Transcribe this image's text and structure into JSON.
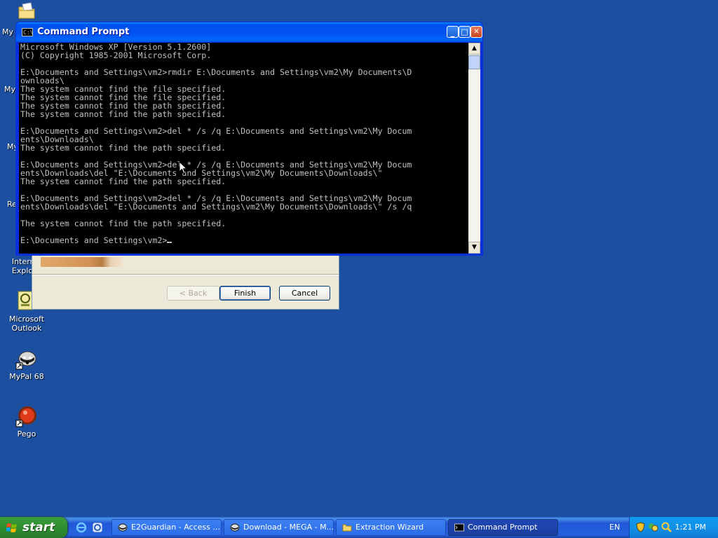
{
  "desktop": {
    "icons": [
      {
        "name": "my-documents-partial",
        "label": "My"
      },
      {
        "name": "my-computer-partial",
        "label": "My"
      },
      {
        "name": "my-network-partial",
        "label": "My"
      },
      {
        "name": "recycle-partial",
        "label": "Re"
      },
      {
        "name": "internet-explorer",
        "label_line1": "Interr",
        "label_line2": "Explo"
      },
      {
        "name": "microsoft-outlook",
        "label_line1": "Microsoft",
        "label_line2": "Outlook"
      },
      {
        "name": "mypal",
        "label": "MyPal 68"
      },
      {
        "name": "pego",
        "label": "Pego"
      }
    ]
  },
  "wizard": {
    "back_label": "< Back",
    "finish_label": "Finish",
    "cancel_label": "Cancel"
  },
  "cmd": {
    "title": "Command Prompt",
    "icon_text": "C:\\",
    "minimize": "_",
    "maximize": "□",
    "close": "✕",
    "lines": [
      "Microsoft Windows XP [Version 5.1.2600]",
      "(C) Copyright 1985-2001 Microsoft Corp.",
      "",
      "E:\\Documents and Settings\\vm2>rmdir E:\\Documents and Settings\\vm2\\My Documents\\D",
      "ownloads\\",
      "The system cannot find the file specified.",
      "The system cannot find the file specified.",
      "The system cannot find the path specified.",
      "The system cannot find the path specified.",
      "",
      "E:\\Documents and Settings\\vm2>del * /s /q E:\\Documents and Settings\\vm2\\My Docum",
      "ents\\Downloads\\",
      "The system cannot find the path specified.",
      "",
      "E:\\Documents and Settings\\vm2>del * /s /q E:\\Documents and Settings\\vm2\\My Docum",
      "ents\\Downloads\\del \"E:\\Documents and Settings\\vm2\\My Documents\\Downloads\\\"",
      "The system cannot find the path specified.",
      "",
      "E:\\Documents and Settings\\vm2>del * /s /q E:\\Documents and Settings\\vm2\\My Docum",
      "ents\\Downloads\\del \"E:\\Documents and Settings\\vm2\\My Documents\\Downloads\\\" /s /q",
      "",
      "The system cannot find the path specified.",
      "",
      "E:\\Documents and Settings\\vm2>"
    ]
  },
  "taskbar": {
    "start_label": "start",
    "tasks": [
      {
        "label": "E2Guardian - Access ...",
        "active": false
      },
      {
        "label": "Download - MEGA - M...",
        "active": false
      },
      {
        "label": "Extraction Wizard",
        "active": false
      },
      {
        "label": "Command Prompt",
        "active": true
      }
    ],
    "language": "EN",
    "clock": "1:21 PM"
  },
  "colors": {
    "desktop_bg": "#1c4fa0",
    "console_bg": "#000000",
    "console_fg": "#c0c0c0",
    "taskbar_blue": "#2663e0",
    "start_green": "#2f8f2f"
  }
}
